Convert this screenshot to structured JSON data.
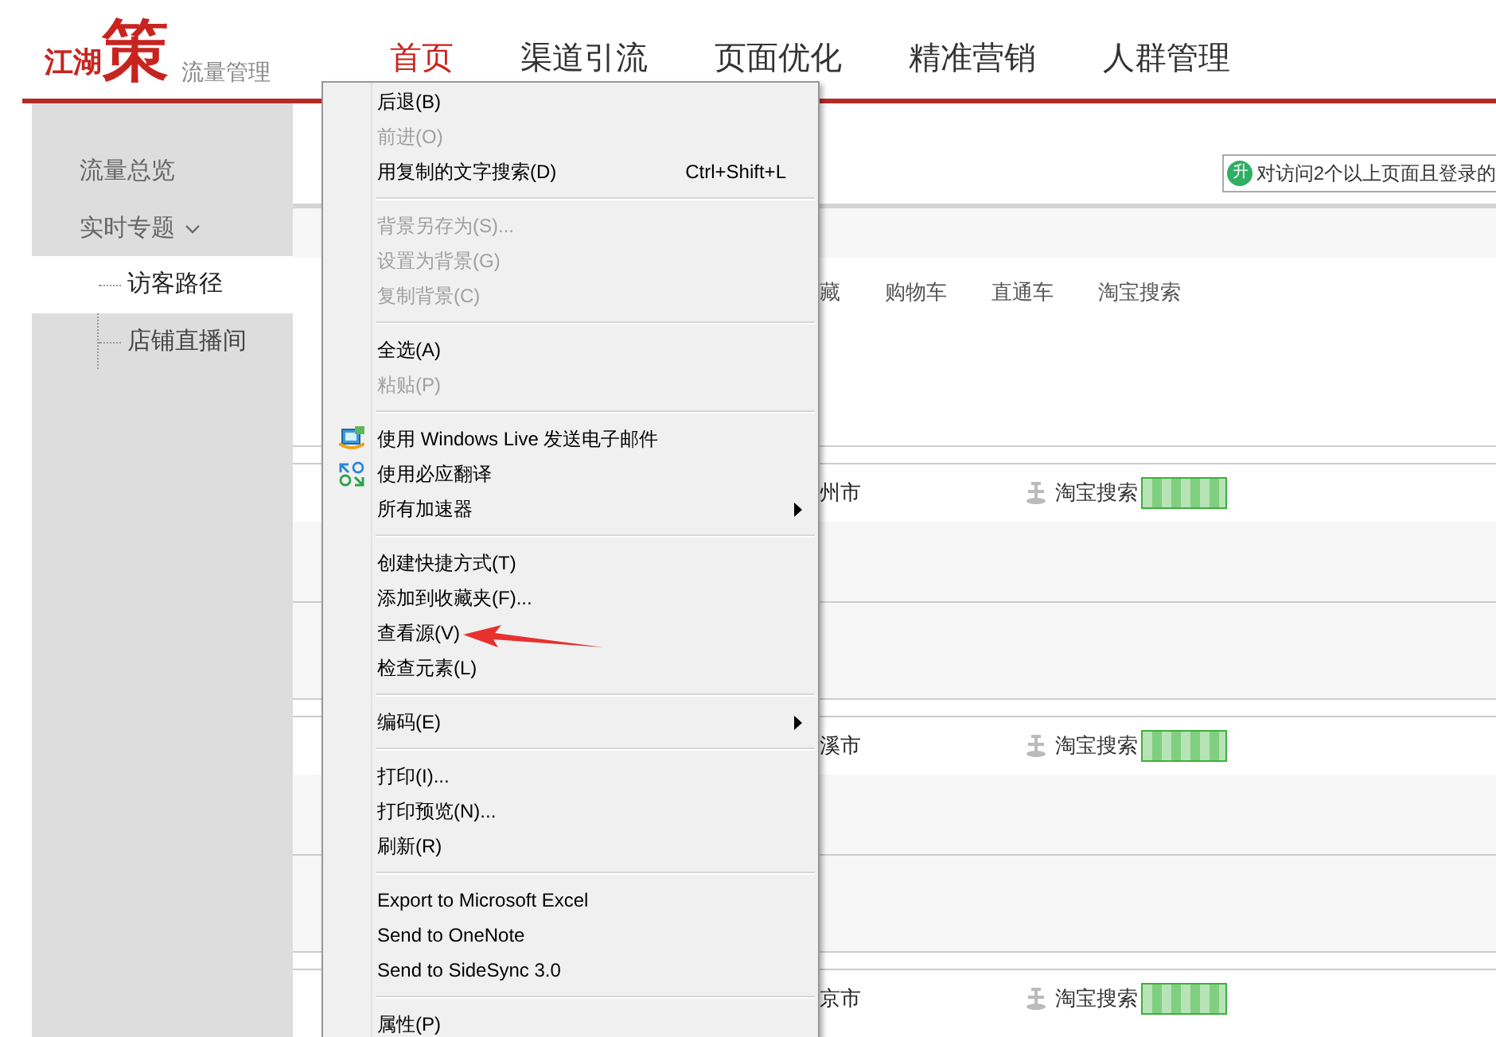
{
  "logo": {
    "brand_small": "江湖",
    "brand_large": "策",
    "subtitle": "流量管理"
  },
  "nav": [
    {
      "label": "首页",
      "selected": true
    },
    {
      "label": "渠道引流",
      "selected": false
    },
    {
      "label": "页面优化",
      "selected": false
    },
    {
      "label": "精准营销",
      "selected": false
    },
    {
      "label": "人群管理",
      "selected": false
    }
  ],
  "sidebar": {
    "items": [
      {
        "label": "流量总览",
        "selected": false
      },
      {
        "label": "实时专题",
        "selected": false,
        "expanded": true,
        "children": [
          {
            "label": "访客路径",
            "selected": true
          },
          {
            "label": "店铺直播间",
            "selected": false
          }
        ]
      }
    ]
  },
  "content": {
    "notice": {
      "badge": "升",
      "text": "对访问2个以上页面且登录的"
    },
    "filters": [
      "藏",
      "购物车",
      "直通车",
      "淘宝搜索"
    ],
    "visits": [
      {
        "city": "州市",
        "source": "淘宝搜索"
      },
      {
        "city": "溪市",
        "source": "淘宝搜索"
      },
      {
        "city": "京市",
        "source": "淘宝搜索"
      }
    ]
  },
  "context_menu": {
    "items": [
      {
        "kind": "item",
        "label": "后退(B)",
        "disabled": false
      },
      {
        "kind": "item",
        "label": "前进(O)",
        "disabled": true
      },
      {
        "kind": "item",
        "label": "用复制的文字搜索(D)",
        "shortcut": "Ctrl+Shift+L",
        "disabled": false
      },
      {
        "kind": "separator"
      },
      {
        "kind": "item",
        "label": "背景另存为(S)...",
        "disabled": true
      },
      {
        "kind": "item",
        "label": "设置为背景(G)",
        "disabled": true
      },
      {
        "kind": "item",
        "label": "复制背景(C)",
        "disabled": true
      },
      {
        "kind": "separator"
      },
      {
        "kind": "item",
        "label": "全选(A)",
        "disabled": false
      },
      {
        "kind": "item",
        "label": "粘贴(P)",
        "disabled": true
      },
      {
        "kind": "separator"
      },
      {
        "kind": "item",
        "label": "使用 Windows Live 发送电子邮件",
        "disabled": false,
        "has_icon": true
      },
      {
        "kind": "item",
        "label": "使用必应翻译",
        "disabled": false,
        "has_icon": true
      },
      {
        "kind": "item",
        "label": "所有加速器",
        "disabled": false,
        "submenu": true
      },
      {
        "kind": "separator"
      },
      {
        "kind": "item",
        "label": "创建快捷方式(T)",
        "disabled": false
      },
      {
        "kind": "item",
        "label": "添加到收藏夹(F)...",
        "disabled": false
      },
      {
        "kind": "item",
        "label": "查看源(V)",
        "disabled": false
      },
      {
        "kind": "item",
        "label": "检查元素(L)",
        "disabled": false
      },
      {
        "kind": "separator"
      },
      {
        "kind": "item",
        "label": "编码(E)",
        "disabled": false,
        "submenu": true
      },
      {
        "kind": "separator"
      },
      {
        "kind": "item",
        "label": "打印(I)...",
        "disabled": false
      },
      {
        "kind": "item",
        "label": "打印预览(N)...",
        "disabled": false
      },
      {
        "kind": "item",
        "label": "刷新(R)",
        "disabled": false
      },
      {
        "kind": "separator"
      },
      {
        "kind": "item",
        "label": "Export to Microsoft Excel",
        "disabled": false
      },
      {
        "kind": "item",
        "label": "Send to OneNote",
        "disabled": false
      },
      {
        "kind": "item",
        "label": "Send to SideSync 3.0",
        "disabled": false
      },
      {
        "kind": "separator"
      },
      {
        "kind": "item",
        "label": "属性(P)",
        "disabled": false
      }
    ]
  }
}
